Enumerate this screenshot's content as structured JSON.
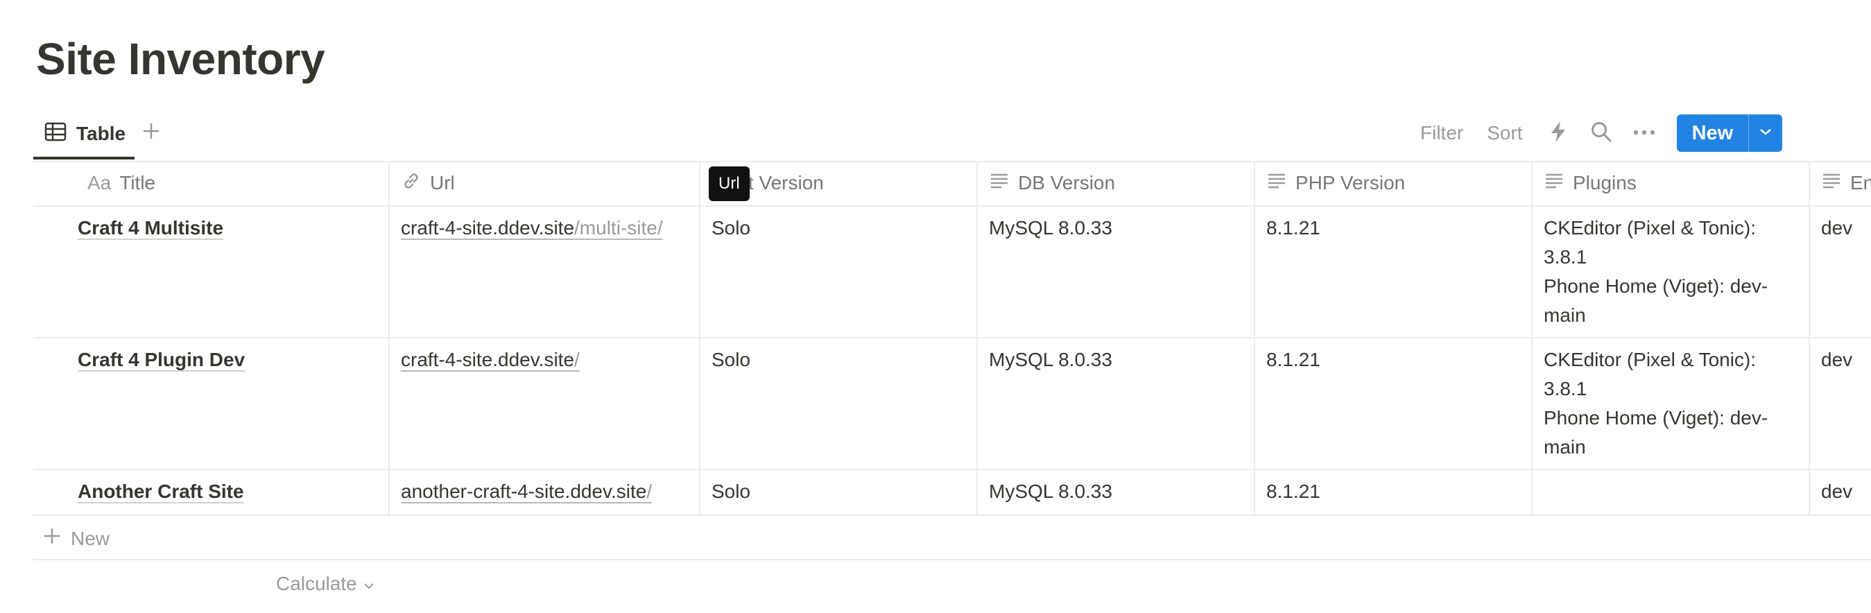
{
  "page": {
    "title": "Site Inventory"
  },
  "views": {
    "active_tab": "Table"
  },
  "toolbar": {
    "filter": "Filter",
    "sort": "Sort",
    "new_label": "New"
  },
  "table": {
    "columns": [
      {
        "label": "Title",
        "type_badge": "Aa"
      },
      {
        "label": "Url"
      },
      {
        "label": "Craft Version"
      },
      {
        "label": "DB Version"
      },
      {
        "label": "PHP Version"
      },
      {
        "label": "Plugins"
      },
      {
        "label": "En"
      }
    ],
    "rows": [
      {
        "title": "Craft 4 Multisite",
        "url_host": "craft-4-site.ddev.site",
        "url_path": "/multi-site/",
        "craft_version": "Solo",
        "db_version": "MySQL 8.0.33",
        "php_version": "8.1.21",
        "plugins_line1": "CKEditor (Pixel & Tonic):",
        "plugins_line2": "3.8.1",
        "plugins_line3": "Phone Home (Viget): dev-",
        "plugins_line4": "main",
        "env": "dev"
      },
      {
        "title": "Craft 4 Plugin Dev",
        "url_host": "craft-4-site.ddev.site",
        "url_path": "/",
        "craft_version": "Solo",
        "db_version": "MySQL 8.0.33",
        "php_version": "8.1.21",
        "plugins_line1": "CKEditor (Pixel & Tonic):",
        "plugins_line2": "3.8.1",
        "plugins_line3": "Phone Home (Viget): dev-",
        "plugins_line4": "main",
        "env": "dev"
      },
      {
        "title": "Another Craft Site",
        "url_host": "another-craft-4-site.ddev.site",
        "url_path": "/",
        "craft_version": "Solo",
        "db_version": "MySQL 8.0.33",
        "php_version": "8.1.21",
        "plugins_line1": "",
        "plugins_line2": "",
        "plugins_line3": "",
        "plugins_line4": "",
        "env": "dev"
      }
    ],
    "tooltip": "Url",
    "new_row_label": "New",
    "calculate_label": "Calculate"
  },
  "colors": {
    "accent": "#2383e2",
    "text": "#37352f",
    "muted": "#9b9a97",
    "border": "#ebebea"
  }
}
